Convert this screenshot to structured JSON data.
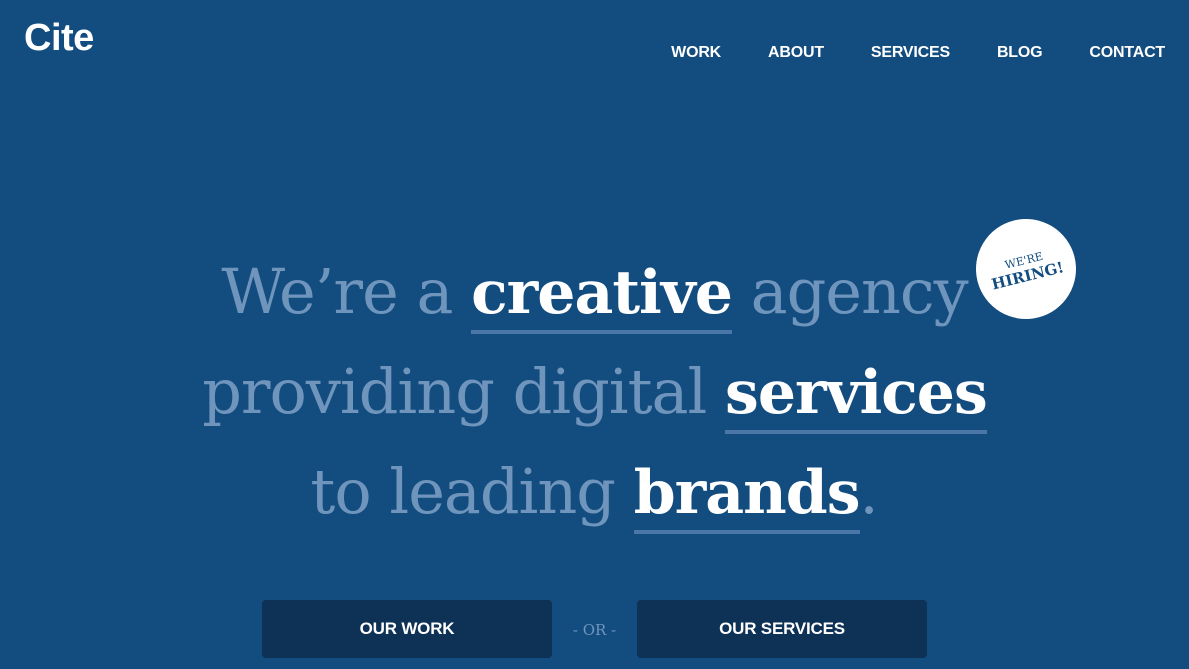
{
  "header": {
    "logo": "Cite",
    "nav": [
      {
        "label": "WORK"
      },
      {
        "label": "ABOUT"
      },
      {
        "label": "SERVICES"
      },
      {
        "label": "BLOG"
      },
      {
        "label": "CONTACT"
      }
    ]
  },
  "hero": {
    "line1": {
      "pre": "We’re a ",
      "bold": "creative",
      "post": " agency"
    },
    "line2": {
      "pre": "providing digital ",
      "bold": "services",
      "post": ""
    },
    "line3": {
      "pre": "to leading ",
      "bold": "brands",
      "post": "."
    }
  },
  "badge": {
    "top": "WE'RE",
    "main": "HIRING!"
  },
  "cta": {
    "primary": "OUR WORK",
    "separator": "- OR -",
    "secondary": "OUR SERVICES"
  },
  "colors": {
    "background": "#134c7f",
    "muted_text": "#6f95bd",
    "underline": "#4a77a8",
    "button": "#0e3156"
  }
}
